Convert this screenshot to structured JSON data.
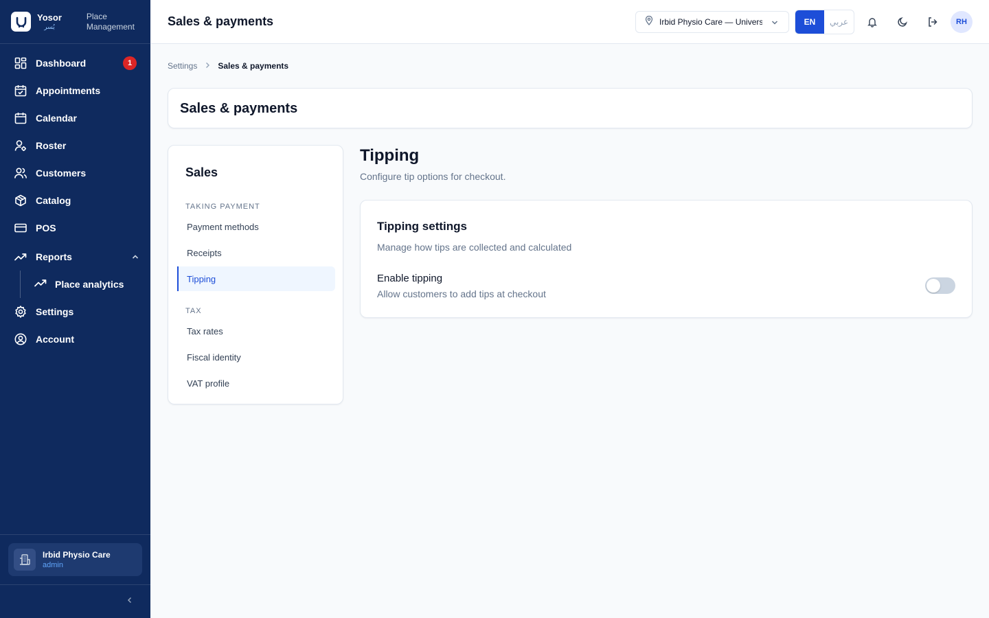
{
  "brand": {
    "name": "Yosor",
    "name_ar": "يُسر",
    "subtitle": "Place Management"
  },
  "sidebar": {
    "items": [
      {
        "label": "Dashboard",
        "icon": "dashboard-icon",
        "badge": "1"
      },
      {
        "label": "Appointments",
        "icon": "calendar-check-icon"
      },
      {
        "label": "Calendar",
        "icon": "calendar-icon"
      },
      {
        "label": "Roster",
        "icon": "user-cog-icon"
      },
      {
        "label": "Customers",
        "icon": "users-icon"
      },
      {
        "label": "Catalog",
        "icon": "box-icon"
      },
      {
        "label": "POS",
        "icon": "credit-card-icon"
      },
      {
        "label": "Reports",
        "icon": "trending-up-icon",
        "expanded": true
      },
      {
        "label": "Place analytics",
        "icon": "trending-up-icon",
        "sub": true
      },
      {
        "label": "Settings",
        "icon": "gear-icon"
      },
      {
        "label": "Account",
        "icon": "user-circle-icon"
      }
    ],
    "org": {
      "name": "Irbid Physio Care",
      "role": "admin"
    }
  },
  "header": {
    "title": "Sales & payments",
    "location": "Irbid Physio Care — University St.",
    "lang_en": "EN",
    "lang_ar": "عربي",
    "avatar": "RH"
  },
  "breadcrumb": {
    "parent": "Settings",
    "current": "Sales & payments"
  },
  "page_title": "Sales & payments",
  "settings_nav": {
    "title": "Sales",
    "sections": [
      {
        "heading": "TAKING PAYMENT",
        "items": [
          "Payment methods",
          "Receipts",
          "Tipping"
        ]
      },
      {
        "heading": "TAX",
        "items": [
          "Tax rates",
          "Fiscal identity",
          "VAT profile"
        ]
      }
    ],
    "active": "Tipping"
  },
  "tipping": {
    "title": "Tipping",
    "description": "Configure tip options for checkout.",
    "card_title": "Tipping settings",
    "card_description": "Manage how tips are collected and calculated",
    "toggle_label": "Enable tipping",
    "toggle_description": "Allow customers to add tips at checkout",
    "enabled": false
  },
  "colors": {
    "sidebar_bg": "#0f2a5e",
    "accent": "#1d4ed8",
    "badge": "#dc2626"
  }
}
